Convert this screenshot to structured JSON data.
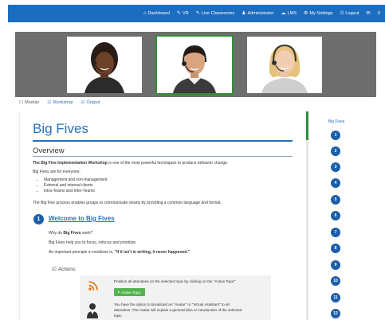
{
  "nav": {
    "items": [
      {
        "icon": "⌂",
        "label": "Dashboard"
      },
      {
        "icon": "✎",
        "label": "VR"
      },
      {
        "icon": "✎",
        "label": "Live Classrooms"
      },
      {
        "icon": "♟",
        "label": "Administrator"
      },
      {
        "icon": "☁",
        "label": "LMS"
      },
      {
        "icon": "⚙",
        "label": "My Settings"
      },
      {
        "icon": "⏻",
        "label": "Logout"
      },
      {
        "icon": "✉",
        "label": ""
      },
      {
        "icon": "≡",
        "label": ""
      }
    ]
  },
  "tabs": [
    {
      "icon": "☐",
      "label": "Module"
    },
    {
      "icon": "☑",
      "label": "Workshop"
    },
    {
      "icon": "☑",
      "label": "Output"
    }
  ],
  "main": {
    "title": "Big Fives",
    "overview_heading": "Overview",
    "intro_bold": "The Big Five Implementation Workshop",
    "intro_rest": " is one of the most powerful techniques to produce behavior change.",
    "for_everyone": "Big Fives are for everyone:",
    "bullets": [
      "Management and non-management",
      "External and internal clients",
      "Intra-Teams and Inter-Teams"
    ],
    "enables": "The Big Five process enables groups to communicate clearly by providing a common language and format.",
    "step_number": "1",
    "step_title": "Welcome to Big Fives",
    "why_prefix": "Why do ",
    "why_bold": "Big Fives",
    "why_suffix": " work?",
    "helps": "Big Fives help you to focus, refocus and prioritize.",
    "principle_prefix": "An important principle in medicine is, ",
    "principle_bold": "\"If it isn't in writing, it never happened.\"",
    "actions_label": "Actions:",
    "action1": "Position all attendees on the selected topic by clicking on the \"Active Topic\"",
    "active_topic_label": "Active Topic",
    "action2_line1": "You have the option to broadcast an \"Avatar\" or \"Virtual Assistant\" to all",
    "action2_line2": "attendees. The Avatar will explain a general idea or introduction of the selected",
    "action2_line3": "topic."
  },
  "sidebar": {
    "title": "Big Fives",
    "steps": [
      "1",
      "2",
      "3",
      "4",
      "5",
      "6",
      "7",
      "8",
      "9",
      "10",
      "11",
      "12"
    ]
  },
  "colors": {
    "nav": "#1c6dc0",
    "accent_blue": "#2a6fb8",
    "step_blue": "#1c5ea8",
    "active_green": "#56b34f",
    "video_band": "#6e6e6e"
  }
}
